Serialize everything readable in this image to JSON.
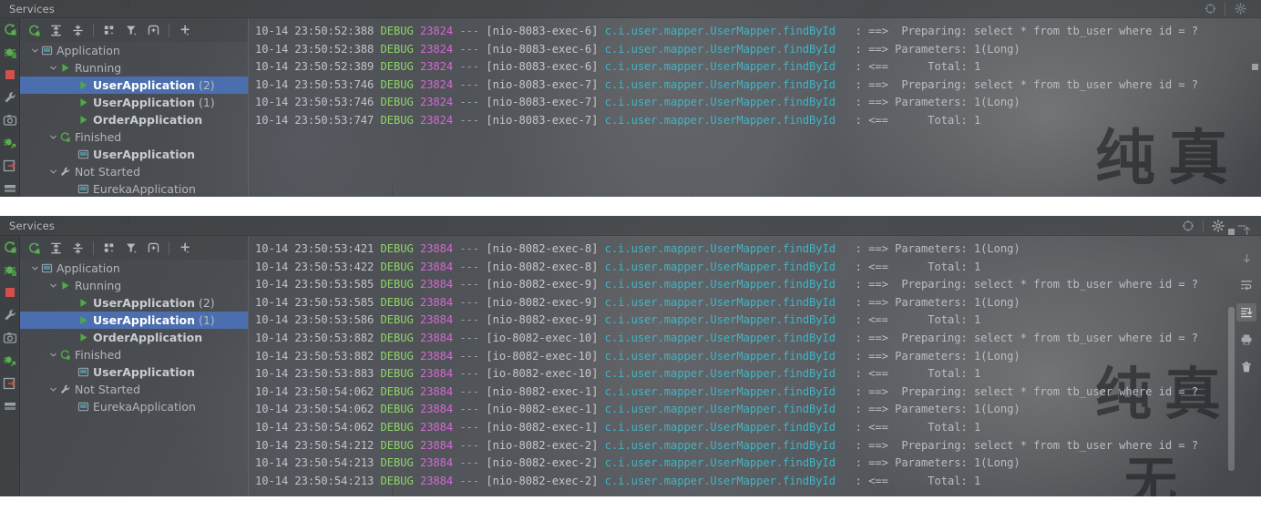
{
  "panels": [
    {
      "id": "top",
      "title": "Services",
      "titlebar_buttons": [
        "settings-target-icon",
        "gear-icon"
      ],
      "toolbar": [
        {
          "name": "rerun-icon",
          "label": "Rerun"
        },
        {
          "name": "expand-all-icon",
          "label": "Expand All"
        },
        {
          "name": "collapse-all-icon",
          "label": "Collapse All"
        },
        {
          "name": "group-by-icon",
          "label": "Group By"
        },
        {
          "name": "filter-icon",
          "label": "Filter"
        },
        {
          "name": "add-tab-icon",
          "label": "Add Tab"
        },
        {
          "name": "add-icon",
          "label": "Add Service"
        }
      ],
      "activity_icons": [
        "rerun-service-icon",
        "debug-service-icon",
        "stop-icon",
        "settings-wrench-icon",
        "camera-icon",
        "attach-debugger-icon",
        "export-icon",
        "layout-icon"
      ],
      "tree": [
        {
          "depth": 0,
          "chevron": "down",
          "icon": "application-icon",
          "label": "Application",
          "bold": false,
          "selected": false
        },
        {
          "depth": 1,
          "chevron": "down",
          "icon": "run-green-icon",
          "label": "Running",
          "bold": false,
          "selected": false
        },
        {
          "depth": 2,
          "chevron": "none",
          "icon": "run-green-icon",
          "label": "UserApplication",
          "suffix": " (2)",
          "bold": true,
          "selected": true
        },
        {
          "depth": 2,
          "chevron": "none",
          "icon": "run-green-icon",
          "label": "UserApplication",
          "suffix": " (1)",
          "bold": true,
          "selected": false
        },
        {
          "depth": 2,
          "chevron": "none",
          "icon": "run-green-icon",
          "label": "OrderApplication",
          "suffix": "",
          "bold": true,
          "selected": false
        },
        {
          "depth": 1,
          "chevron": "down",
          "icon": "rerun-green-icon",
          "label": "Finished",
          "bold": false,
          "selected": false
        },
        {
          "depth": 2,
          "chevron": "none",
          "icon": "application-icon",
          "label": "UserApplication",
          "suffix": "",
          "bold": true,
          "selected": false
        },
        {
          "depth": 1,
          "chevron": "down",
          "icon": "wrench-icon",
          "label": "Not Started",
          "bold": false,
          "selected": false
        },
        {
          "depth": 2,
          "chevron": "none",
          "icon": "application-icon",
          "label": "EurekaApplication",
          "suffix": "",
          "bold": false,
          "selected": false
        }
      ],
      "log": [
        {
          "ts": "10-14 23:50:52:388",
          "level": "DEBUG",
          "pid": "23824",
          "dash": "---",
          "thread": "[nio-8083-exec-6]",
          "cls": "c.i.user.mapper.UserMapper.findById",
          "msg": ": ==>  Preparing: select * from tb_user where id = ?"
        },
        {
          "ts": "10-14 23:50:52:388",
          "level": "DEBUG",
          "pid": "23824",
          "dash": "---",
          "thread": "[nio-8083-exec-6]",
          "cls": "c.i.user.mapper.UserMapper.findById",
          "msg": ": ==> Parameters: 1(Long)"
        },
        {
          "ts": "10-14 23:50:52:389",
          "level": "DEBUG",
          "pid": "23824",
          "dash": "---",
          "thread": "[nio-8083-exec-6]",
          "cls": "c.i.user.mapper.UserMapper.findById",
          "msg": ": <==      Total: 1"
        },
        {
          "ts": "10-14 23:50:53:746",
          "level": "DEBUG",
          "pid": "23824",
          "dash": "---",
          "thread": "[nio-8083-exec-7]",
          "cls": "c.i.user.mapper.UserMapper.findById",
          "msg": ": ==>  Preparing: select * from tb_user where id = ?"
        },
        {
          "ts": "10-14 23:50:53:746",
          "level": "DEBUG",
          "pid": "23824",
          "dash": "---",
          "thread": "[nio-8083-exec-7]",
          "cls": "c.i.user.mapper.UserMapper.findById",
          "msg": ": ==> Parameters: 1(Long)"
        },
        {
          "ts": "10-14 23:50:53:747",
          "level": "DEBUG",
          "pid": "23824",
          "dash": "---",
          "thread": "[nio-8083-exec-7]",
          "cls": "c.i.user.mapper.UserMapper.findById",
          "msg": ": <==      Total: 1"
        }
      ]
    },
    {
      "id": "bottom",
      "title": "Services",
      "titlebar_buttons": [
        "settings-target-icon",
        "gear-icon",
        "minimize-icon"
      ],
      "toolbar": [
        {
          "name": "rerun-icon",
          "label": "Rerun"
        },
        {
          "name": "expand-all-icon",
          "label": "Expand All"
        },
        {
          "name": "collapse-all-icon",
          "label": "Collapse All"
        },
        {
          "name": "group-by-icon",
          "label": "Group By"
        },
        {
          "name": "filter-icon",
          "label": "Filter"
        },
        {
          "name": "add-tab-icon",
          "label": "Add Tab"
        },
        {
          "name": "add-icon",
          "label": "Add Service"
        }
      ],
      "activity_icons": [
        "rerun-service-icon",
        "debug-service-icon",
        "stop-icon",
        "settings-wrench-icon",
        "camera-icon",
        "attach-debugger-icon",
        "export-icon",
        "layout-icon"
      ],
      "console_actions": [
        {
          "name": "scroll-up-icon",
          "label": "Up",
          "active": false
        },
        {
          "name": "scroll-down-icon",
          "label": "Down",
          "active": false
        },
        {
          "name": "soft-wrap-icon",
          "label": "Soft-Wrap",
          "active": false
        },
        {
          "name": "scroll-to-end-icon",
          "label": "Scroll to End",
          "active": true
        },
        {
          "name": "print-icon",
          "label": "Print",
          "active": false
        },
        {
          "name": "trash-icon",
          "label": "Clear All",
          "active": false
        }
      ],
      "tree": [
        {
          "depth": 0,
          "chevron": "down",
          "icon": "application-icon",
          "label": "Application",
          "bold": false,
          "selected": false
        },
        {
          "depth": 1,
          "chevron": "down",
          "icon": "run-green-icon",
          "label": "Running",
          "bold": false,
          "selected": false
        },
        {
          "depth": 2,
          "chevron": "none",
          "icon": "run-green-icon",
          "label": "UserApplication",
          "suffix": " (2)",
          "bold": true,
          "selected": false
        },
        {
          "depth": 2,
          "chevron": "none",
          "icon": "run-green-icon",
          "label": "UserApplication",
          "suffix": " (1)",
          "bold": true,
          "selected": true
        },
        {
          "depth": 2,
          "chevron": "none",
          "icon": "run-green-icon",
          "label": "OrderApplication",
          "suffix": "",
          "bold": true,
          "selected": false
        },
        {
          "depth": 1,
          "chevron": "down",
          "icon": "rerun-green-icon",
          "label": "Finished",
          "bold": false,
          "selected": false
        },
        {
          "depth": 2,
          "chevron": "none",
          "icon": "application-icon",
          "label": "UserApplication",
          "suffix": "",
          "bold": true,
          "selected": false
        },
        {
          "depth": 1,
          "chevron": "down",
          "icon": "wrench-icon",
          "label": "Not Started",
          "bold": false,
          "selected": false
        },
        {
          "depth": 2,
          "chevron": "none",
          "icon": "application-icon",
          "label": "EurekaApplication",
          "suffix": "",
          "bold": false,
          "selected": false
        }
      ],
      "log": [
        {
          "ts": "10-14 23:50:53:421",
          "level": "DEBUG",
          "pid": "23884",
          "dash": "---",
          "thread": "[nio-8082-exec-8]",
          "cls": "c.i.user.mapper.UserMapper.findById",
          "msg": ": ==> Parameters: 1(Long)"
        },
        {
          "ts": "10-14 23:50:53:422",
          "level": "DEBUG",
          "pid": "23884",
          "dash": "---",
          "thread": "[nio-8082-exec-8]",
          "cls": "c.i.user.mapper.UserMapper.findById",
          "msg": ": <==      Total: 1"
        },
        {
          "ts": "10-14 23:50:53:585",
          "level": "DEBUG",
          "pid": "23884",
          "dash": "---",
          "thread": "[nio-8082-exec-9]",
          "cls": "c.i.user.mapper.UserMapper.findById",
          "msg": ": ==>  Preparing: select * from tb_user where id = ?"
        },
        {
          "ts": "10-14 23:50:53:585",
          "level": "DEBUG",
          "pid": "23884",
          "dash": "---",
          "thread": "[nio-8082-exec-9]",
          "cls": "c.i.user.mapper.UserMapper.findById",
          "msg": ": ==> Parameters: 1(Long)"
        },
        {
          "ts": "10-14 23:50:53:586",
          "level": "DEBUG",
          "pid": "23884",
          "dash": "---",
          "thread": "[nio-8082-exec-9]",
          "cls": "c.i.user.mapper.UserMapper.findById",
          "msg": ": <==      Total: 1"
        },
        {
          "ts": "10-14 23:50:53:882",
          "level": "DEBUG",
          "pid": "23884",
          "dash": "---",
          "thread": "[io-8082-exec-10]",
          "cls": "c.i.user.mapper.UserMapper.findById",
          "msg": ": ==>  Preparing: select * from tb_user where id = ?"
        },
        {
          "ts": "10-14 23:50:53:882",
          "level": "DEBUG",
          "pid": "23884",
          "dash": "---",
          "thread": "[io-8082-exec-10]",
          "cls": "c.i.user.mapper.UserMapper.findById",
          "msg": ": ==> Parameters: 1(Long)"
        },
        {
          "ts": "10-14 23:50:53:883",
          "level": "DEBUG",
          "pid": "23884",
          "dash": "---",
          "thread": "[io-8082-exec-10]",
          "cls": "c.i.user.mapper.UserMapper.findById",
          "msg": ": <==      Total: 1"
        },
        {
          "ts": "10-14 23:50:54:062",
          "level": "DEBUG",
          "pid": "23884",
          "dash": "---",
          "thread": "[nio-8082-exec-1]",
          "cls": "c.i.user.mapper.UserMapper.findById",
          "msg": ": ==>  Preparing: select * from tb_user where id = ?"
        },
        {
          "ts": "10-14 23:50:54:062",
          "level": "DEBUG",
          "pid": "23884",
          "dash": "---",
          "thread": "[nio-8082-exec-1]",
          "cls": "c.i.user.mapper.UserMapper.findById",
          "msg": ": ==> Parameters: 1(Long)"
        },
        {
          "ts": "10-14 23:50:54:062",
          "level": "DEBUG",
          "pid": "23884",
          "dash": "---",
          "thread": "[nio-8082-exec-1]",
          "cls": "c.i.user.mapper.UserMapper.findById",
          "msg": ": <==      Total: 1"
        },
        {
          "ts": "10-14 23:50:54:212",
          "level": "DEBUG",
          "pid": "23884",
          "dash": "---",
          "thread": "[nio-8082-exec-2]",
          "cls": "c.i.user.mapper.UserMapper.findById",
          "msg": ": ==>  Preparing: select * from tb_user where id = ?"
        },
        {
          "ts": "10-14 23:50:54:213",
          "level": "DEBUG",
          "pid": "23884",
          "dash": "---",
          "thread": "[nio-8082-exec-2]",
          "cls": "c.i.user.mapper.UserMapper.findById",
          "msg": ": ==> Parameters: 1(Long)"
        },
        {
          "ts": "10-14 23:50:54:213",
          "level": "DEBUG",
          "pid": "23884",
          "dash": "---",
          "thread": "[nio-8082-exec-2]",
          "cls": "c.i.user.mapper.UserMapper.findById",
          "msg": ": <==      Total: 1"
        }
      ]
    }
  ],
  "wallpaper": {
    "text_top": "纯真",
    "text_bottom_1": "纯真",
    "text_bottom_2": "无"
  },
  "colors": {
    "selection": "#4b6eaf",
    "level_debug": "#8fd46a",
    "pid": "#d368d4",
    "class": "#3fb5c4",
    "timestamp": "#bfc3c7",
    "message": "#b9bdc2",
    "panel_bg": "#3c3f41"
  }
}
